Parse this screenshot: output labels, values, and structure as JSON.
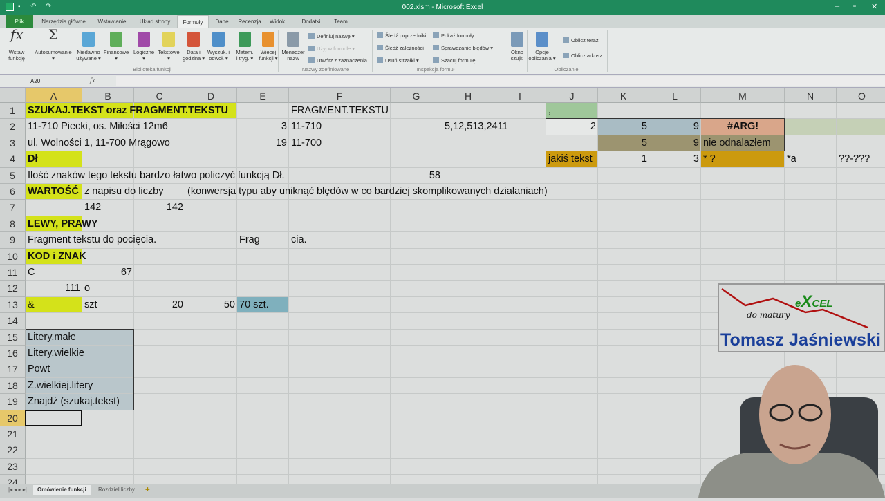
{
  "window": {
    "title": "002.xlsm - Microsoft Excel"
  },
  "tabs": [
    "Plik",
    "Narzędzia główne",
    "Wstawianie",
    "Układ strony",
    "Formuły",
    "Dane",
    "Recenzja",
    "Widok",
    "Dodatki",
    "Team"
  ],
  "active_tab": "Formuły",
  "ribbon": {
    "big": [
      {
        "label": "Wstaw\nfunkcję",
        "icon": "fx-icon"
      },
      {
        "label": "Autosumowanie\n▾",
        "icon": "sigma-icon"
      },
      {
        "label": "Niedawno\nużywane ▾",
        "icon": "book-blue-icon",
        "color": "#5aa7d6"
      },
      {
        "label": "Finansowe\n▾",
        "icon": "book-green-icon",
        "color": "#5fae5a"
      },
      {
        "label": "Logiczne\n▾",
        "icon": "book-purple-icon",
        "color": "#a04aa8"
      },
      {
        "label": "Tekstowe\n▾",
        "icon": "book-yellow-icon",
        "color": "#e2d35a"
      },
      {
        "label": "Data i\ngodzina ▾",
        "icon": "book-red-icon",
        "color": "#d4553a"
      },
      {
        "label": "Wyszuk. i\nodwoł. ▾",
        "icon": "book-lookup-icon",
        "color": "#4f8fc9"
      },
      {
        "label": "Matem.\ni tryg. ▾",
        "icon": "book-math-icon",
        "color": "#3e9a5a"
      },
      {
        "label": "Więcej\nfunkcji ▾",
        "icon": "books-orange-icon",
        "color": "#e8912f"
      },
      {
        "label": "Menedżer\nnazw",
        "icon": "name-manager-icon",
        "color": "#8a9aa8"
      },
      {
        "label": "Okno\nczujki",
        "icon": "watch-window-icon",
        "color": "#7a9ab8"
      },
      {
        "label": "Opcje\nobliczania ▾",
        "icon": "calc-options-icon",
        "color": "#5b8fc9"
      }
    ],
    "small": [
      "Definiuj nazwę ▾",
      "Użyj w formule ▾",
      "Utwórz z zaznaczenia",
      "Śledź poprzedniki",
      "Śledź zależności",
      "Usuń strzałki ▾",
      "Pokaż formuły",
      "Sprawdzanie błędów ▾",
      "Szacuj formułę",
      "Oblicz teraz",
      "Oblicz arkusz"
    ],
    "groups": [
      "Biblioteka funkcji",
      "Nazwy zdefiniowane",
      "Inspekcja formuł",
      "Obliczanie"
    ]
  },
  "formula_bar": {
    "name_box": "A20",
    "fx": "fx",
    "value": ""
  },
  "columns": [
    "A",
    "B",
    "C",
    "D",
    "E",
    "F",
    "G",
    "H",
    "I",
    "J",
    "K",
    "L",
    "M",
    "N",
    "O"
  ],
  "rows": [
    "1",
    "2",
    "3",
    "4",
    "5",
    "6",
    "7",
    "8",
    "9",
    "10",
    "11",
    "12",
    "13",
    "14",
    "15",
    "16",
    "17",
    "18",
    "19",
    "20",
    "21",
    "22",
    "23",
    "24"
  ],
  "fills": [
    {
      "range": "A1:D1",
      "color": "#d4e21a"
    },
    {
      "range": "J1:J1",
      "color": "#9fc79a"
    },
    {
      "range": "J2:J2",
      "color": "#e6e8e7"
    },
    {
      "range": "K2:L2",
      "color": "#a9bcc4"
    },
    {
      "range": "M2:M2",
      "color": "#d9a68a"
    },
    {
      "range": "N2:O2",
      "color": "#c5d0b6"
    },
    {
      "range": "K3:L3",
      "color": "#9c9470"
    },
    {
      "range": "M3:M3",
      "color": "#9c9470"
    },
    {
      "range": "A4:A4",
      "color": "#d4e21a"
    },
    {
      "range": "J4:J4",
      "color": "#cc9a0e"
    },
    {
      "range": "M4:M4",
      "color": "#cc9a0e"
    },
    {
      "range": "A6:A6",
      "color": "#d4e21a"
    },
    {
      "range": "A8:A8",
      "color": "#d4e21a"
    },
    {
      "range": "A10:A10",
      "color": "#d4e21a"
    },
    {
      "range": "A13:A13",
      "color": "#d4e21a"
    },
    {
      "range": "E13:E13",
      "color": "#7fb0bd"
    },
    {
      "range": "A15:B19",
      "color": "#b9c6cb"
    }
  ],
  "cells": [
    {
      "ref": "A1",
      "text": "SZUKAJ.TEKST   oraz   FRAGMENT.TEKSTU",
      "b": true
    },
    {
      "ref": "F1",
      "text": "FRAGMENT.TEKSTU"
    },
    {
      "ref": "J1",
      "text": ","
    },
    {
      "ref": "A2",
      "text": "11-710 Piecki, os. Miłości 12m6"
    },
    {
      "ref": "E2",
      "text": "3",
      "al": "r"
    },
    {
      "ref": "F2",
      "text": "11-710"
    },
    {
      "ref": "H2",
      "text": "5,12,513,2411"
    },
    {
      "ref": "J2",
      "text": "2",
      "al": "r"
    },
    {
      "ref": "K2",
      "text": "5",
      "al": "r"
    },
    {
      "ref": "L2",
      "text": "9",
      "al": "r"
    },
    {
      "ref": "M2",
      "text": "#ARG!",
      "al": "c",
      "b": true
    },
    {
      "ref": "A3",
      "text": "ul. Wolności 1, 11-700 Mrągowo"
    },
    {
      "ref": "E3",
      "text": "19",
      "al": "r"
    },
    {
      "ref": "F3",
      "text": "11-700"
    },
    {
      "ref": "K3",
      "text": "5",
      "al": "r"
    },
    {
      "ref": "L3",
      "text": "9",
      "al": "r"
    },
    {
      "ref": "M3",
      "text": "nie odnalazłem"
    },
    {
      "ref": "A4",
      "text": "Dł",
      "b": true
    },
    {
      "ref": "J4",
      "text": "jakiś tekst"
    },
    {
      "ref": "K4",
      "text": "1",
      "al": "r"
    },
    {
      "ref": "L4",
      "text": "3",
      "al": "r"
    },
    {
      "ref": "M4",
      "text": "*  ?"
    },
    {
      "ref": "N4",
      "text": "*a"
    },
    {
      "ref": "O4",
      "text": "??-???"
    },
    {
      "ref": "A5",
      "text": "Ilość znaków tego tekstu bardzo łatwo policzyć funkcją Dł."
    },
    {
      "ref": "G5",
      "text": "58",
      "al": "r"
    },
    {
      "ref": "A6",
      "text": "WARTOŚĆ",
      "b": true
    },
    {
      "ref": "B6",
      "text": "z napisu do liczby"
    },
    {
      "ref": "D6",
      "text": "(konwersja typu aby uniknąć błędów w co bardziej skomplikowanych działaniach)"
    },
    {
      "ref": "B7",
      "text": "142"
    },
    {
      "ref": "C7",
      "text": "142",
      "al": "r"
    },
    {
      "ref": "A8",
      "text": "LEWY, PRAWY",
      "b": true
    },
    {
      "ref": "A9",
      "text": "Fragment tekstu do pocięcia."
    },
    {
      "ref": "E9",
      "text": "Frag"
    },
    {
      "ref": "F9",
      "text": "cia."
    },
    {
      "ref": "A10",
      "text": "KOD i ZNAK",
      "b": true
    },
    {
      "ref": "A11",
      "text": "C"
    },
    {
      "ref": "B11",
      "text": "67",
      "al": "r"
    },
    {
      "ref": "A12",
      "text": "111",
      "al": "r"
    },
    {
      "ref": "B12",
      "text": "o"
    },
    {
      "ref": "A13",
      "text": "&"
    },
    {
      "ref": "B13",
      "text": "szt"
    },
    {
      "ref": "C13",
      "text": "20",
      "al": "r"
    },
    {
      "ref": "D13",
      "text": "50",
      "al": "r"
    },
    {
      "ref": "E13",
      "text": "70 szt."
    },
    {
      "ref": "A15",
      "text": "Litery.małe"
    },
    {
      "ref": "A16",
      "text": "Litery.wielkie"
    },
    {
      "ref": "A17",
      "text": "Powt"
    },
    {
      "ref": "A18",
      "text": "Z.wielkiej.litery"
    },
    {
      "ref": "A19",
      "text": "Znajdź (szukaj.tekst)"
    }
  ],
  "selected_cell": "A20",
  "sheet_tabs": [
    "Omówienie funkcji",
    "Rozdziel liczby"
  ],
  "active_sheet": "Omówienie funkcji",
  "logo": {
    "excel": "eXCEL",
    "subtitle": "do matury",
    "author": "Tomasz  Jaśniewski"
  }
}
